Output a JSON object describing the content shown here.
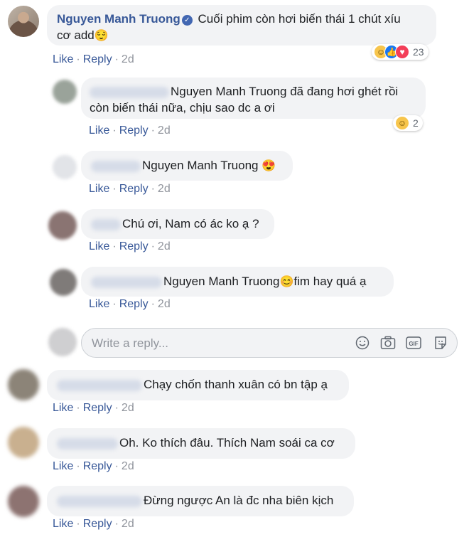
{
  "main_comment": {
    "author": "Nguyen Manh Truong",
    "text_line1": "Cuối phim còn hơi biến thái 1 chút xíu",
    "text_line2": "cơ add",
    "emoji": "😌",
    "reaction_count": "23",
    "like": "Like",
    "reply": "Reply",
    "time": "2d"
  },
  "replies": [
    {
      "mention": "Nguyen Manh Truong",
      "text_line1": " đã đang hơi ghét rồi",
      "text_line2": "còn biến thái nữa, chịu sao dc a ơi",
      "reaction_count": "2",
      "like": "Like",
      "reply": "Reply",
      "time": "2d"
    },
    {
      "mention": "Nguyen Manh Truong",
      "text": " ",
      "emoji": "😍",
      "like": "Like",
      "reply": "Reply",
      "time": "2d"
    },
    {
      "text": "Chú ơi, Nam có ác ko ạ ?",
      "like": "Like",
      "reply": "Reply",
      "time": "2d"
    },
    {
      "mention": "Nguyen Manh Truong",
      "emoji": "😊",
      "text": "fim hay quá ạ",
      "like": "Like",
      "reply": "Reply",
      "time": "2d"
    }
  ],
  "reply_box": {
    "placeholder": "Write a reply..."
  },
  "comments": [
    {
      "text": "Chạy chốn thanh xuân có bn tập ạ",
      "like": "Like",
      "reply": "Reply",
      "time": "2d"
    },
    {
      "text": "Oh. Ko thích đâu. Thích Nam soái ca cơ",
      "like": "Like",
      "reply": "Reply",
      "time": "2d"
    },
    {
      "text": "Đừng ngược An là đc nha biên kịch",
      "like": "Like",
      "reply": "Reply",
      "time": "2d"
    }
  ],
  "separator": "·",
  "icons": [
    "verified-icon",
    "haha-reaction-icon",
    "like-reaction-icon",
    "love-reaction-icon",
    "smiley-icon",
    "camera-icon",
    "gif-icon",
    "sticker-icon"
  ]
}
